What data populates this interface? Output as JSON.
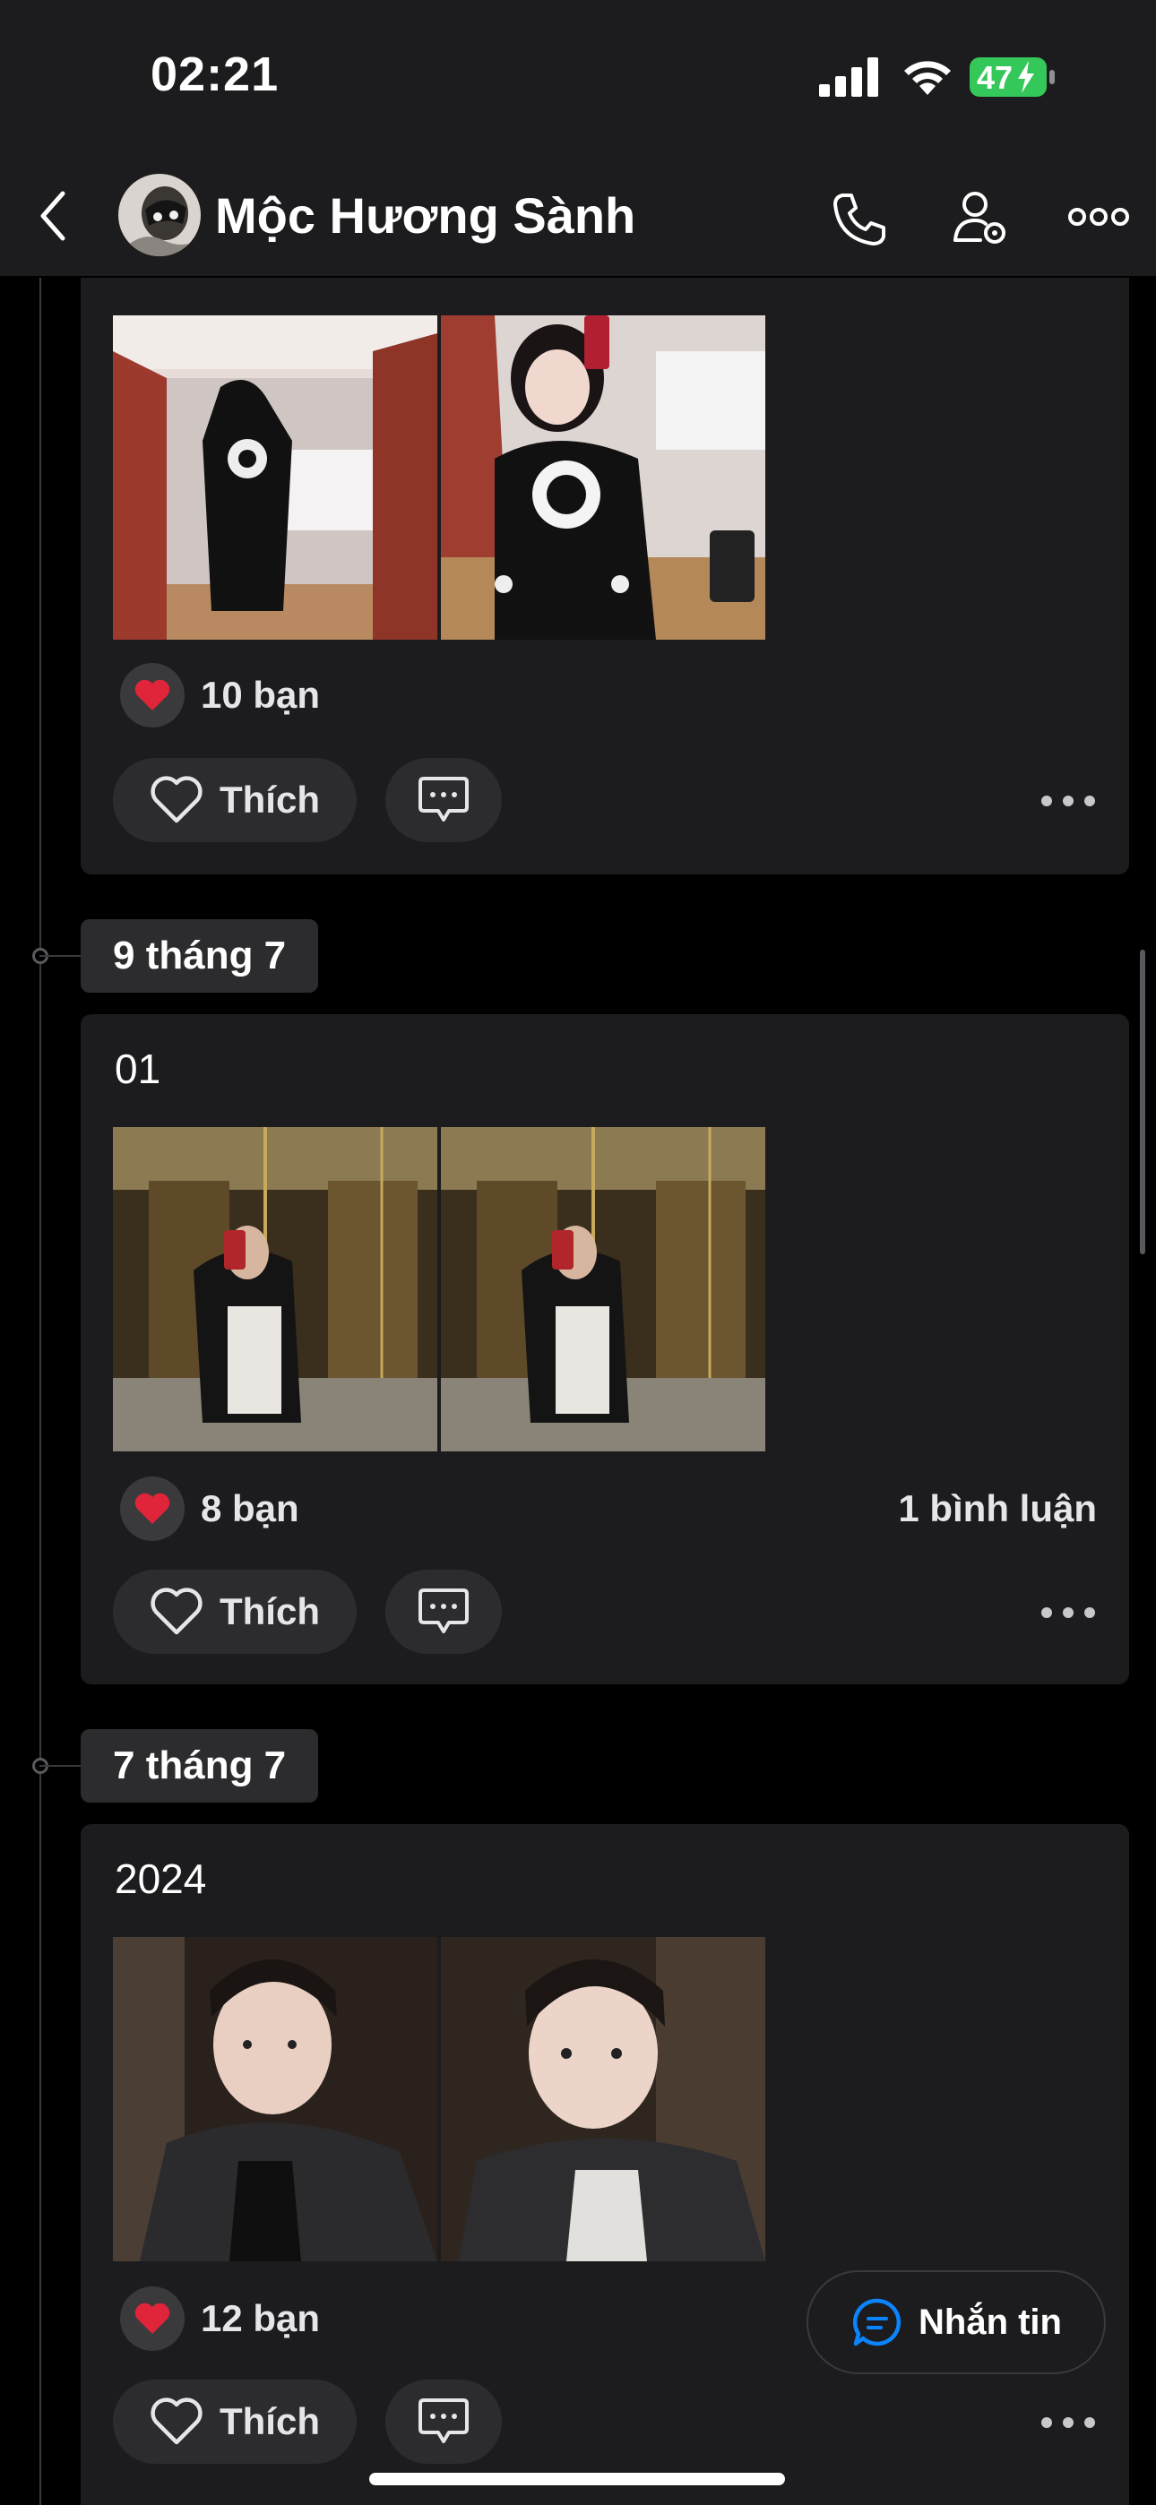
{
  "status_bar": {
    "time": "02:21",
    "battery": "47"
  },
  "header": {
    "title": "Mộc Hương Sành"
  },
  "posts": [
    {
      "likes": "10 bạn",
      "like_label": "Thích"
    },
    {
      "date": "9 tháng 7",
      "caption": "01",
      "likes": "8 bạn",
      "comments": "1 bình luận",
      "like_label": "Thích"
    },
    {
      "date": "7 tháng 7",
      "caption": "2024",
      "likes": "12 bạn",
      "like_label": "Thích"
    }
  ],
  "message_button": {
    "label": "Nhắn tin"
  },
  "colors": {
    "background": "#000000",
    "card": "#1c1c1e",
    "pill": "#2c2c2e",
    "heart": "#e0243a",
    "battery": "#34c759",
    "accent": "#0a84ff"
  }
}
